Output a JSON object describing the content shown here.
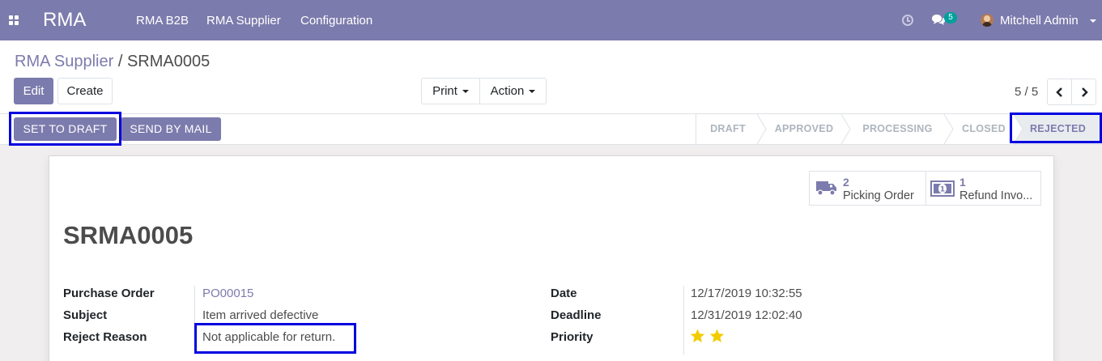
{
  "navbar": {
    "brand": "RMA",
    "menu": [
      "RMA B2B",
      "RMA Supplier",
      "Configuration"
    ],
    "chat_count": "5",
    "user_name": "Mitchell Admin",
    "icons": [
      "apps-icon",
      "clock-icon",
      "chat-icon",
      "avatar",
      "chevron-down-icon"
    ]
  },
  "breadcrumb": {
    "parent": "RMA Supplier",
    "separator": " / ",
    "current": "SRMA0005"
  },
  "actions": {
    "edit": "Edit",
    "create": "Create",
    "print": "Print",
    "action": "Action"
  },
  "pager": {
    "value": "5 / 5"
  },
  "statusbar": {
    "buttons": [
      "SET TO DRAFT",
      "SEND BY MAIL"
    ],
    "stages": [
      "DRAFT",
      "APPROVED",
      "PROCESSING",
      "CLOSED",
      "REJECTED"
    ],
    "active_stage": "REJECTED"
  },
  "smart_buttons": [
    {
      "count": "2",
      "label": "Picking Order",
      "icon": "truck-icon"
    },
    {
      "count": "1",
      "label": "Refund Invo...",
      "icon": "money-icon"
    }
  ],
  "record": {
    "name": "SRMA0005",
    "left_fields": [
      {
        "label": "Purchase Order",
        "value": "PO00015"
      },
      {
        "label": "Subject",
        "value": "Item arrived defective"
      },
      {
        "label": "Reject Reason",
        "value": "Not applicable for return."
      }
    ],
    "right_fields": [
      {
        "label": "Date",
        "value": "12/17/2019 10:32:55"
      },
      {
        "label": "Deadline",
        "value": "12/31/2019 12:02:40"
      },
      {
        "label": "Priority",
        "value": ""
      }
    ],
    "priority_stars": 2
  },
  "colors": {
    "brand": "#7c7bad",
    "highlight": "#0000e0",
    "star": "#f3cc00"
  }
}
